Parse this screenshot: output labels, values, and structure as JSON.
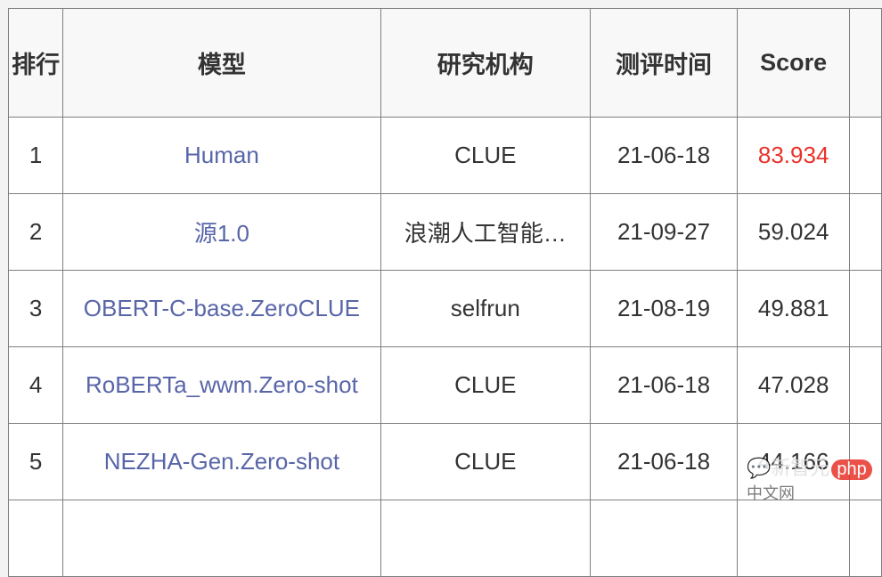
{
  "table": {
    "headers": [
      "排行",
      "模型",
      "研究机构",
      "测评时间",
      "Score"
    ],
    "rows": [
      {
        "rank": "1",
        "model": "Human",
        "org": "CLUE",
        "date": "21-06-18",
        "score": "83.934"
      },
      {
        "rank": "2",
        "model": "源1.0",
        "org": "浪潮人工智能…",
        "date": "21-09-27",
        "score": "59.024"
      },
      {
        "rank": "3",
        "model": "OBERT-C-base.ZeroCLUE",
        "org": "selfrun",
        "date": "21-08-19",
        "score": "49.881"
      },
      {
        "rank": "4",
        "model": "RoBERTa_wwm.Zero-shot",
        "org": "CLUE",
        "date": "21-06-18",
        "score": "47.028"
      },
      {
        "rank": "5",
        "model": "NEZHA-Gen.Zero-shot",
        "org": "CLUE",
        "date": "21-06-18",
        "score": "44.166"
      }
    ]
  },
  "colors": {
    "link": "#5865a8",
    "highlight_score": "#e8332a",
    "text": "#333333"
  },
  "watermark": {
    "source": "新智元",
    "php_badge": "php",
    "site": "中文网"
  }
}
